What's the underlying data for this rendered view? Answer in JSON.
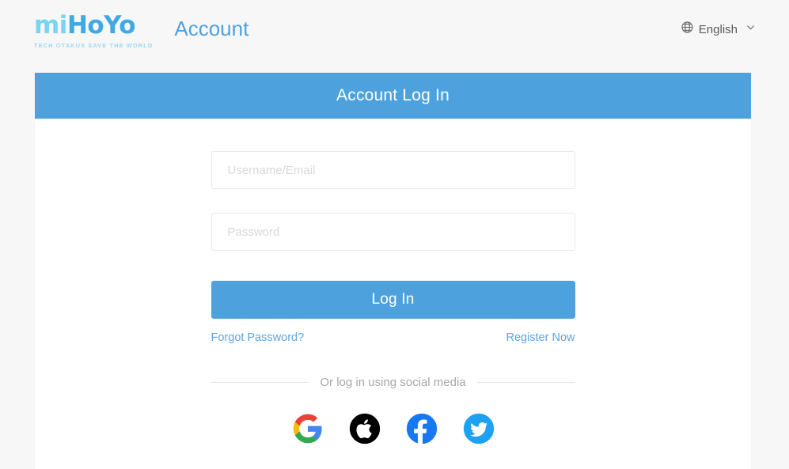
{
  "header": {
    "logo": {
      "part1": "mi",
      "part2": "HoYo",
      "tagline": "TECH OTAKUS SAVE THE WORLD",
      "colors": {
        "part1": "#79d3f2",
        "part2": "#3fa9e5",
        "tagline": "#9fd9f0"
      }
    },
    "title": "Account",
    "title_color": "#4ea0e2",
    "language": {
      "label": "English",
      "icon": "globe-icon",
      "chevron": "chevron-down-icon"
    }
  },
  "card": {
    "header_title": "Account Log In",
    "accent_color": "#4da2dd",
    "username": {
      "value": "",
      "placeholder": "Username/Email"
    },
    "password": {
      "value": "",
      "placeholder": "Password"
    },
    "login_button": "Log In",
    "forgot_password_link": "Forgot Password?",
    "register_link": "Register Now",
    "link_color": "#5aa6e0",
    "social_divider_text": "Or log in using social media",
    "socials": [
      {
        "name": "google",
        "label": "Google",
        "color": "#ffffff"
      },
      {
        "name": "apple",
        "label": "Apple",
        "color": "#000000"
      },
      {
        "name": "facebook",
        "label": "Facebook",
        "color": "#1877f2"
      },
      {
        "name": "twitter",
        "label": "Twitter",
        "color": "#1da1f2"
      }
    ]
  }
}
